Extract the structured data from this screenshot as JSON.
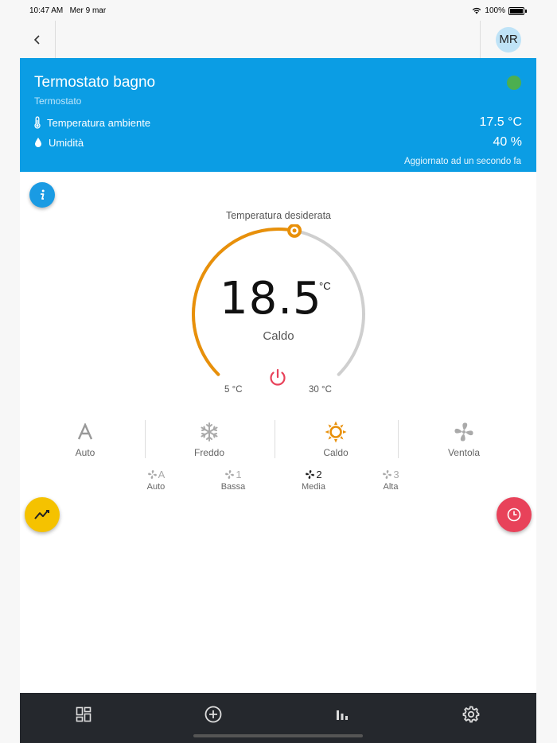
{
  "status_bar": {
    "time": "10:47 AM",
    "date": "Mer 9 mar",
    "battery": "100%"
  },
  "navbar": {
    "back_icon": "chevron-left-icon",
    "avatar_initials": "MR"
  },
  "device": {
    "name": "Termostato bagno",
    "type": "Termostato",
    "status_color": "#4caf50",
    "ambient_label": "Temperatura ambiente",
    "ambient_value": "17.5 °C",
    "humidity_label": "Umidità",
    "humidity_value": "40 %",
    "updated": "Aggiornato ad un secondo fa"
  },
  "dial": {
    "title": "Temperatura desiderata",
    "value": "18.5",
    "unit": "°C",
    "mode": "Caldo",
    "min_label": "5 °C",
    "max_label": "30 °C",
    "min": 5,
    "max": 30,
    "current": 18.5,
    "accent": "#e8900a"
  },
  "modes": [
    {
      "label": "Auto",
      "icon": "auto-a-icon",
      "active": false
    },
    {
      "label": "Freddo",
      "icon": "snowflake-icon",
      "active": false
    },
    {
      "label": "Caldo",
      "icon": "sun-icon",
      "active": true
    },
    {
      "label": "Ventola",
      "icon": "fan-icon",
      "active": false
    }
  ],
  "fan_speeds": [
    {
      "label": "Auto",
      "suffix": "A",
      "active": false
    },
    {
      "label": "Bassa",
      "suffix": "1",
      "active": false
    },
    {
      "label": "Media",
      "suffix": "2",
      "active": true
    },
    {
      "label": "Alta",
      "suffix": "3",
      "active": false
    }
  ],
  "colors": {
    "header": "#0b9de4",
    "chart_fab": "#f5c200",
    "schedule_fab": "#e8425a",
    "power": "#e8425a",
    "tabbar": "#25282d"
  },
  "tabs": [
    {
      "icon": "dashboard-icon"
    },
    {
      "icon": "add-circle-icon"
    },
    {
      "icon": "bar-chart-icon"
    },
    {
      "icon": "gear-icon"
    }
  ]
}
